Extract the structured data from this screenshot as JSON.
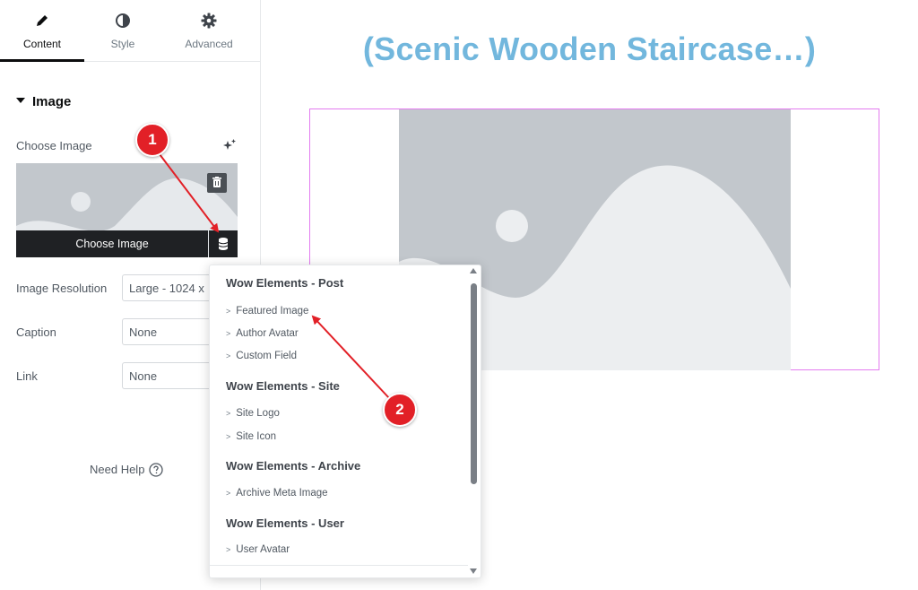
{
  "tabs": [
    {
      "label": "Content",
      "icon": "pencil-icon",
      "active": true
    },
    {
      "label": "Style",
      "icon": "contrast-icon",
      "active": false
    },
    {
      "label": "Advanced",
      "icon": "gear-icon",
      "active": false
    }
  ],
  "section": {
    "title": "Image"
  },
  "fields": {
    "choose_image_label": "Choose Image",
    "choose_image_button": "Choose Image",
    "resolution_label": "Image Resolution",
    "resolution_value": "Large - 1024 x",
    "caption_label": "Caption",
    "caption_value": "None",
    "link_label": "Link",
    "link_value": "None"
  },
  "help": {
    "label": "Need Help"
  },
  "canvas": {
    "heading": "(Scenic Wooden Staircase…)"
  },
  "dropdown": {
    "groups": [
      {
        "title": "Wow Elements - Post",
        "items": [
          "Featured Image",
          "Author Avatar",
          "Custom Field"
        ]
      },
      {
        "title": "Wow Elements - Site",
        "items": [
          "Site Logo",
          "Site Icon"
        ]
      },
      {
        "title": "Wow Elements - Archive",
        "items": [
          "Archive Meta Image"
        ]
      },
      {
        "title": "Wow Elements - User",
        "items": [
          "User Avatar"
        ]
      }
    ]
  },
  "annotations": {
    "marker_1": "1",
    "marker_2": "2"
  },
  "colors": {
    "heading": "#72b7dd",
    "widget_border": "#e37bf0",
    "marker": "#e22027",
    "placeholder": "#c2c7cc"
  }
}
